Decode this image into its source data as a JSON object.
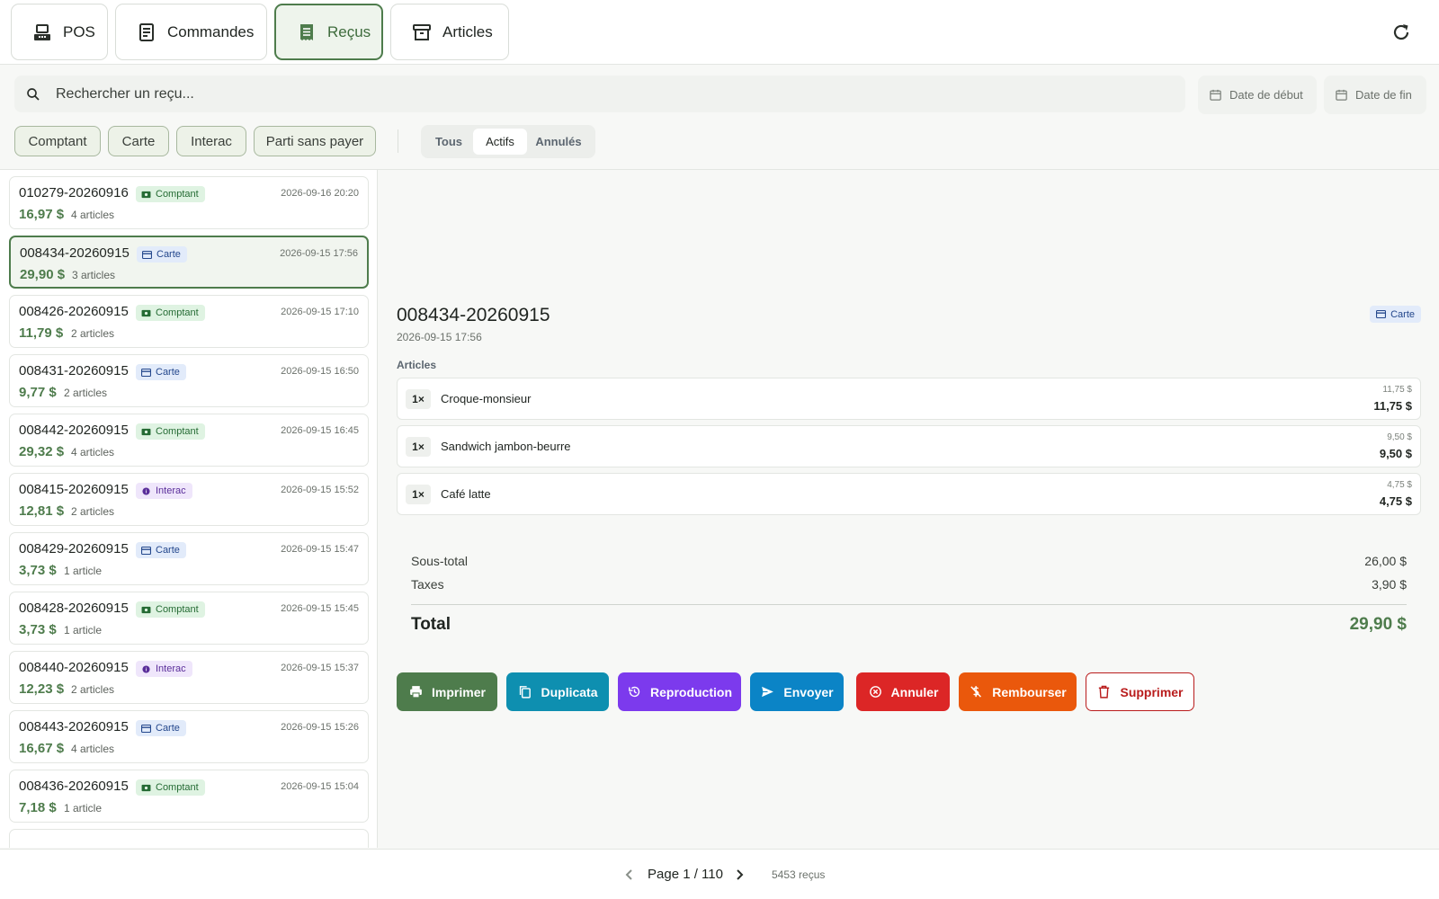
{
  "tabs": [
    {
      "label": "POS",
      "icon": "cash-register-icon"
    },
    {
      "label": "Commandes",
      "icon": "order-list-icon"
    },
    {
      "label": "Reçus",
      "icon": "receipt-icon"
    },
    {
      "label": "Articles",
      "icon": "archive-box-icon"
    }
  ],
  "active_tab": "Reçus",
  "search": {
    "placeholder": "Rechercher un reçu..."
  },
  "date_start": "Date de début",
  "date_end": "Date de fin",
  "payment_filters": [
    "Comptant",
    "Carte",
    "Interac",
    "Parti sans payer"
  ],
  "status_filters": [
    "Tous",
    "Actifs",
    "Annulés"
  ],
  "active_status": "Actifs",
  "receipts": [
    {
      "id": "010279-20260916",
      "method": "Comptant",
      "date": "2026-09-16 20:20",
      "amount": "16,97 $",
      "count": "4 articles"
    },
    {
      "id": "008434-20260915",
      "method": "Carte",
      "date": "2026-09-15 17:56",
      "amount": "29,90 $",
      "count": "3 articles"
    },
    {
      "id": "008426-20260915",
      "method": "Comptant",
      "date": "2026-09-15 17:10",
      "amount": "11,79 $",
      "count": "2 articles"
    },
    {
      "id": "008431-20260915",
      "method": "Carte",
      "date": "2026-09-15 16:50",
      "amount": "9,77 $",
      "count": "2 articles"
    },
    {
      "id": "008442-20260915",
      "method": "Comptant",
      "date": "2026-09-15 16:45",
      "amount": "29,32 $",
      "count": "4 articles"
    },
    {
      "id": "008415-20260915",
      "method": "Interac",
      "date": "2026-09-15 15:52",
      "amount": "12,81 $",
      "count": "2 articles"
    },
    {
      "id": "008429-20260915",
      "method": "Carte",
      "date": "2026-09-15 15:47",
      "amount": "3,73 $",
      "count": "1 article"
    },
    {
      "id": "008428-20260915",
      "method": "Comptant",
      "date": "2026-09-15 15:45",
      "amount": "3,73 $",
      "count": "1 article"
    },
    {
      "id": "008440-20260915",
      "method": "Interac",
      "date": "2026-09-15 15:37",
      "amount": "12,23 $",
      "count": "2 articles"
    },
    {
      "id": "008443-20260915",
      "method": "Carte",
      "date": "2026-09-15 15:26",
      "amount": "16,67 $",
      "count": "4 articles"
    },
    {
      "id": "008436-20260915",
      "method": "Comptant",
      "date": "2026-09-15 15:04",
      "amount": "7,18 $",
      "count": "1 article"
    }
  ],
  "selected_index": 1,
  "detail": {
    "id": "008434-20260915",
    "date": "2026-09-15 17:56",
    "method": "Carte",
    "section_label": "Articles",
    "items": [
      {
        "qty": "1×",
        "name": "Croque-monsieur",
        "unit": "11,75 $",
        "total": "11,75 $"
      },
      {
        "qty": "1×",
        "name": "Sandwich jambon-beurre",
        "unit": "9,50 $",
        "total": "9,50 $"
      },
      {
        "qty": "1×",
        "name": "Café latte",
        "unit": "4,75 $",
        "total": "4,75 $"
      }
    ],
    "subtotal_label": "Sous-total",
    "subtotal": "26,00 $",
    "tax_label": "Taxes",
    "tax": "3,90 $",
    "total_label": "Total",
    "total": "29,90 $"
  },
  "actions": [
    {
      "label": "Imprimer",
      "icon": "printer-icon",
      "color": "#4e7c4c"
    },
    {
      "label": "Duplicata",
      "icon": "copy-icon",
      "color": "#0e8fb0"
    },
    {
      "label": "Reproduction",
      "icon": "history-icon",
      "color": "#7c3aed"
    },
    {
      "label": "Envoyer",
      "icon": "send-icon",
      "color": "#0b84c6"
    },
    {
      "label": "Annuler",
      "icon": "cancel-circle-icon",
      "color": "#dc2626"
    },
    {
      "label": "Rembourser",
      "icon": "refund-icon",
      "color": "#ea580c"
    },
    {
      "label": "Supprimer",
      "icon": "trash-icon",
      "color": "#b91c1c"
    }
  ],
  "pagination": {
    "text": "Page 1 / 110",
    "count": "5453 reçus"
  }
}
